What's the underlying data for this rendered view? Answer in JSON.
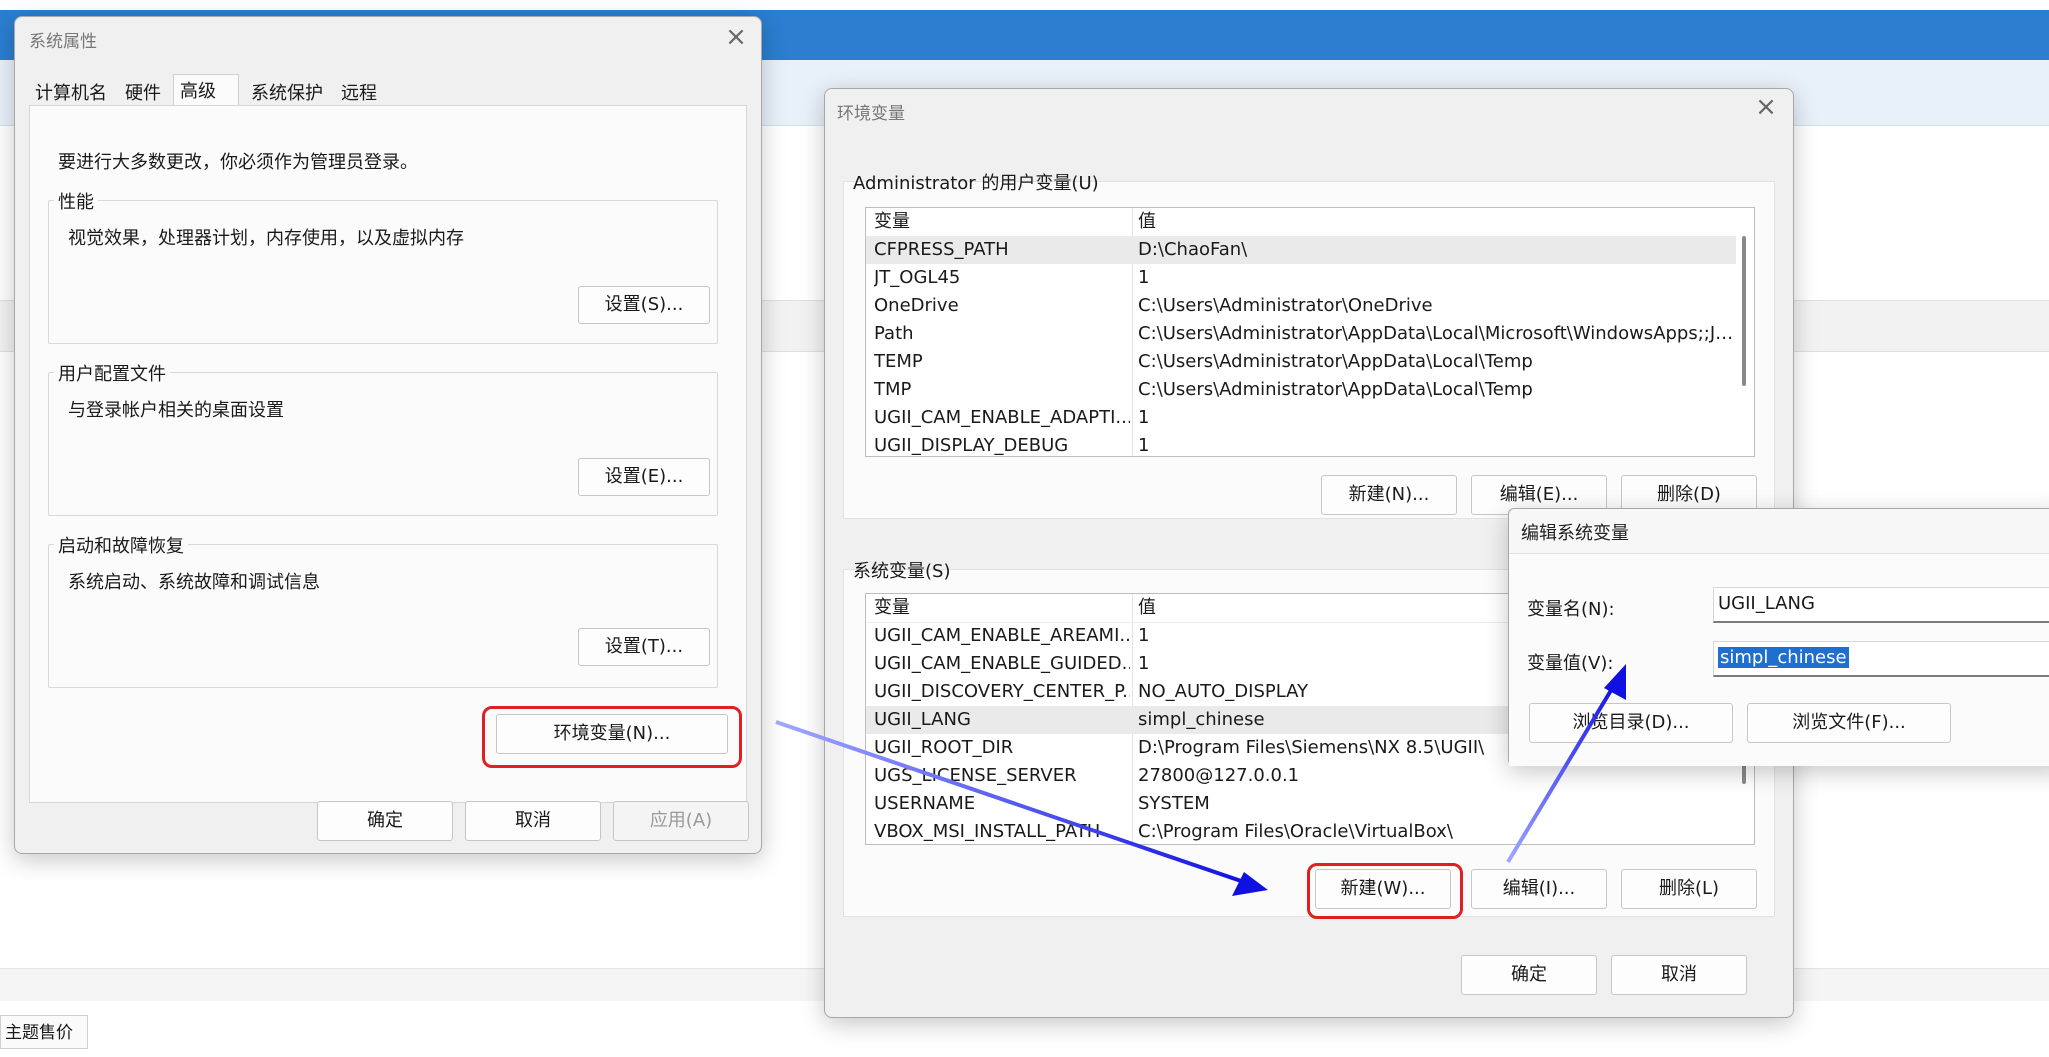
{
  "background": {
    "footer_button": "主题售价",
    "accent_color": "#2b7ed0"
  },
  "sysprops": {
    "title": "系统属性",
    "tabs": [
      "计算机名",
      "硬件",
      "高级",
      "系统保护",
      "远程"
    ],
    "active_tab": "高级",
    "admin_note": "要进行大多数更改，你必须作为管理员登录。",
    "groups": [
      {
        "label": "性能",
        "desc": "视觉效果，处理器计划，内存使用，以及虚拟内存",
        "button": "设置(S)..."
      },
      {
        "label": "用户配置文件",
        "desc": "与登录帐户相关的桌面设置",
        "button": "设置(E)..."
      },
      {
        "label": "启动和故障恢复",
        "desc": "系统启动、系统故障和调试信息",
        "button": "设置(T)..."
      }
    ],
    "env_button": "环境变量(N)...",
    "ok": "确定",
    "cancel": "取消",
    "apply": "应用(A)"
  },
  "envvars": {
    "title": "环境变量",
    "user_section": "Administrator 的用户变量(U)",
    "col_var": "变量",
    "col_val": "值",
    "user_rows": [
      {
        "name": "CFPRESS_PATH",
        "value": "D:\\ChaoFan\\"
      },
      {
        "name": "JT_OGL45",
        "value": "1"
      },
      {
        "name": "OneDrive",
        "value": "C:\\Users\\Administrator\\OneDrive"
      },
      {
        "name": "Path",
        "value": "C:\\Users\\Administrator\\AppData\\Local\\Microsoft\\WindowsApps;;J:..."
      },
      {
        "name": "TEMP",
        "value": "C:\\Users\\Administrator\\AppData\\Local\\Temp"
      },
      {
        "name": "TMP",
        "value": "C:\\Users\\Administrator\\AppData\\Local\\Temp"
      },
      {
        "name": "UGII_CAM_ENABLE_ADAPTI...",
        "value": "1"
      },
      {
        "name": "UGII_DISPLAY_DEBUG",
        "value": "1"
      }
    ],
    "user_new": "新建(N)...",
    "user_edit": "编辑(E)...",
    "user_delete": "删除(D)",
    "sys_section": "系统变量(S)",
    "sys_rows": [
      {
        "name": "UGII_CAM_ENABLE_AREAMI...",
        "value": "1"
      },
      {
        "name": "UGII_CAM_ENABLE_GUIDED...",
        "value": "1"
      },
      {
        "name": "UGII_DISCOVERY_CENTER_P...",
        "value": "NO_AUTO_DISPLAY"
      },
      {
        "name": "UGII_LANG",
        "value": "simpl_chinese"
      },
      {
        "name": "UGII_ROOT_DIR",
        "value": "D:\\Program Files\\Siemens\\NX 8.5\\UGII\\"
      },
      {
        "name": "UGS_LICENSE_SERVER",
        "value": "27800@127.0.0.1"
      },
      {
        "name": "USERNAME",
        "value": "SYSTEM"
      },
      {
        "name": "VBOX_MSI_INSTALL_PATH",
        "value": "C:\\Program Files\\Oracle\\VirtualBox\\"
      }
    ],
    "sys_new": "新建(W)...",
    "sys_edit": "编辑(I)...",
    "sys_delete": "删除(L)",
    "ok": "确定",
    "cancel": "取消"
  },
  "editvar": {
    "title": "编辑系统变量",
    "name_label": "变量名(N):",
    "name_value": "UGII_LANG",
    "value_label": "变量值(V):",
    "value_value": "simpl_chinese",
    "browse_dir": "浏览目录(D)...",
    "browse_file": "浏览文件(F)..."
  },
  "annotation_colors": {
    "highlight": "#e02020",
    "arrow": "#1010e0"
  }
}
